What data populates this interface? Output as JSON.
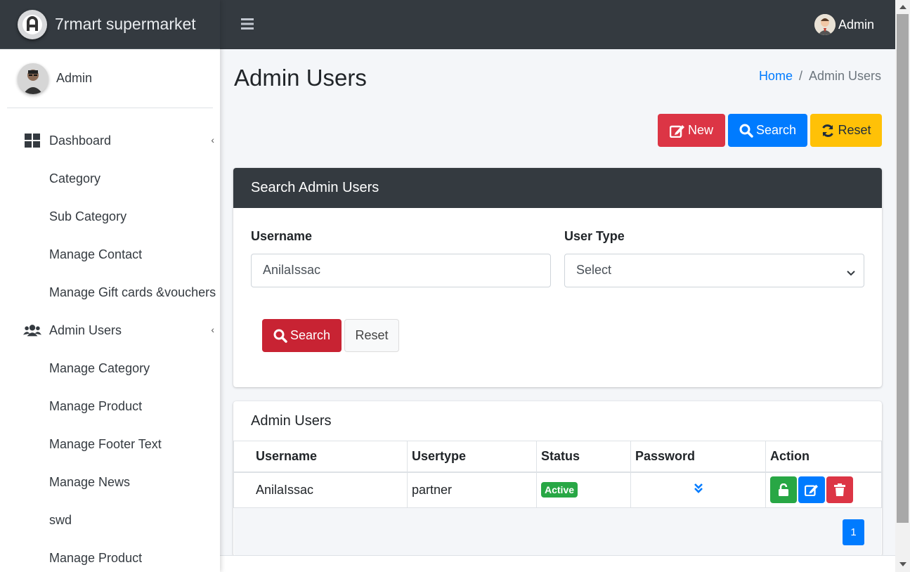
{
  "brand": {
    "name": "7rmart supermarket"
  },
  "sidebar": {
    "user_name": "Admin",
    "items": [
      {
        "label": "Dashboard",
        "icon": "dashboard-icon",
        "has_arrow": true
      },
      {
        "label": "Category"
      },
      {
        "label": "Sub Category"
      },
      {
        "label": "Manage Contact"
      },
      {
        "label": "Manage Gift cards &vouchers"
      },
      {
        "label": "Admin Users",
        "icon": "users-icon",
        "has_arrow": true
      },
      {
        "label": "Manage Category"
      },
      {
        "label": "Manage Product"
      },
      {
        "label": "Manage Footer Text"
      },
      {
        "label": "Manage News"
      },
      {
        "label": "swd"
      },
      {
        "label": "Manage Product"
      }
    ],
    "arrow_glyph": "‹"
  },
  "topbar": {
    "user_label": "Admin"
  },
  "page": {
    "title": "Admin Users",
    "breadcrumb": {
      "home": "Home",
      "separator": "/",
      "current": "Admin Users"
    }
  },
  "actions": {
    "new_label": "New",
    "search_label": "Search",
    "reset_label": "Reset"
  },
  "search_card": {
    "title": "Search Admin Users",
    "username_label": "Username",
    "username_value": "AnilaIssac",
    "usertype_label": "User Type",
    "usertype_value": "Select",
    "search_button": "Search",
    "reset_button": "Reset"
  },
  "list_card": {
    "title": "Admin Users",
    "columns": [
      "Username",
      "Usertype",
      "Status",
      "Password",
      "Action"
    ],
    "rows": [
      {
        "username": "AnilaIssac",
        "usertype": "partner",
        "status": "Active"
      }
    ],
    "pagination": {
      "current": "1"
    }
  },
  "colors": {
    "danger": "#dc3545",
    "primary": "#007bff",
    "warning": "#ffc107",
    "success": "#28a745",
    "dark": "#343a40"
  }
}
